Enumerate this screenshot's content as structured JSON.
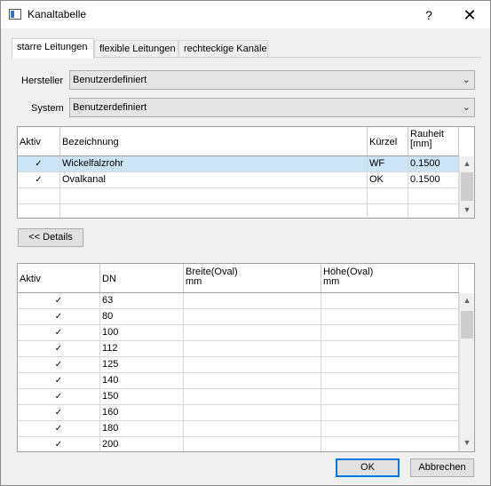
{
  "window": {
    "title": "Kanaltabelle",
    "help_label": "?",
    "close_label": "✕"
  },
  "tabs": [
    {
      "label": "starre Leitungen"
    },
    {
      "label": "flexible Leitungen"
    },
    {
      "label": "rechteckige Kanäle"
    }
  ],
  "hersteller": {
    "label": "Hersteller",
    "value": "Benutzerdefiniert"
  },
  "system": {
    "label": "System",
    "value": "Benutzerdefiniert"
  },
  "table1": {
    "headers": {
      "aktiv": "Aktiv",
      "bezeichnung": "Bezeichnung",
      "kuerzel": "Kürzel",
      "rauheit": "Rauheit",
      "rauheit_unit": "[mm]"
    },
    "rows": [
      {
        "aktiv": "✓",
        "bezeichnung": "Wickelfalzrohr",
        "kuerzel": "WF",
        "rauheit": "0.1500"
      },
      {
        "aktiv": "✓",
        "bezeichnung": "Ovalkanal",
        "kuerzel": "OK",
        "rauheit": "0.1500"
      }
    ]
  },
  "details_button": "<< Details",
  "table2": {
    "headers": {
      "aktiv": "Aktiv",
      "dn": "DN",
      "breite": "Breite(Oval)",
      "breite_unit": "mm",
      "hoehe": "Höhe(Oval)",
      "hoehe_unit": "mm"
    },
    "rows": [
      {
        "aktiv": "✓",
        "dn": "63"
      },
      {
        "aktiv": "✓",
        "dn": "80"
      },
      {
        "aktiv": "✓",
        "dn": "100"
      },
      {
        "aktiv": "✓",
        "dn": "112"
      },
      {
        "aktiv": "✓",
        "dn": "125"
      },
      {
        "aktiv": "✓",
        "dn": "140"
      },
      {
        "aktiv": "✓",
        "dn": "150"
      },
      {
        "aktiv": "✓",
        "dn": "160"
      },
      {
        "aktiv": "✓",
        "dn": "180"
      },
      {
        "aktiv": "✓",
        "dn": "200"
      }
    ]
  },
  "footer": {
    "ok": "OK",
    "cancel": "Abbrechen"
  }
}
